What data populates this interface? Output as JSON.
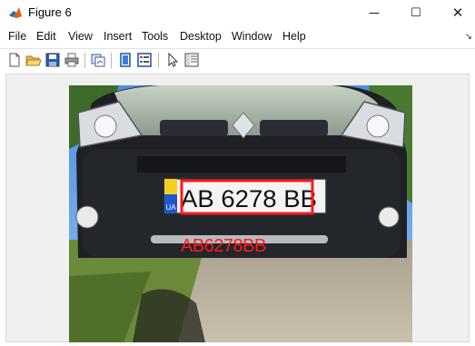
{
  "window": {
    "title": "Figure 6",
    "minimize_glyph": "─",
    "maximize_glyph": "☐",
    "close_glyph": "✕"
  },
  "menu": {
    "items": [
      "File",
      "Edit",
      "View",
      "Insert",
      "Tools",
      "Desktop",
      "Window",
      "Help"
    ]
  },
  "toolbar": {
    "icons": [
      "new-figure-icon",
      "open-file-icon",
      "save-icon",
      "print-icon",
      "link-plot-icon",
      "insert-colorbar-icon",
      "insert-legend-icon",
      "edit-plot-arrow-icon",
      "property-inspector-icon"
    ]
  },
  "image": {
    "plate_text": "AB 6278 BB",
    "plate_country": "UA",
    "recognized_text": "AB6278BB",
    "detection_box_color": "#ff1a1a"
  }
}
